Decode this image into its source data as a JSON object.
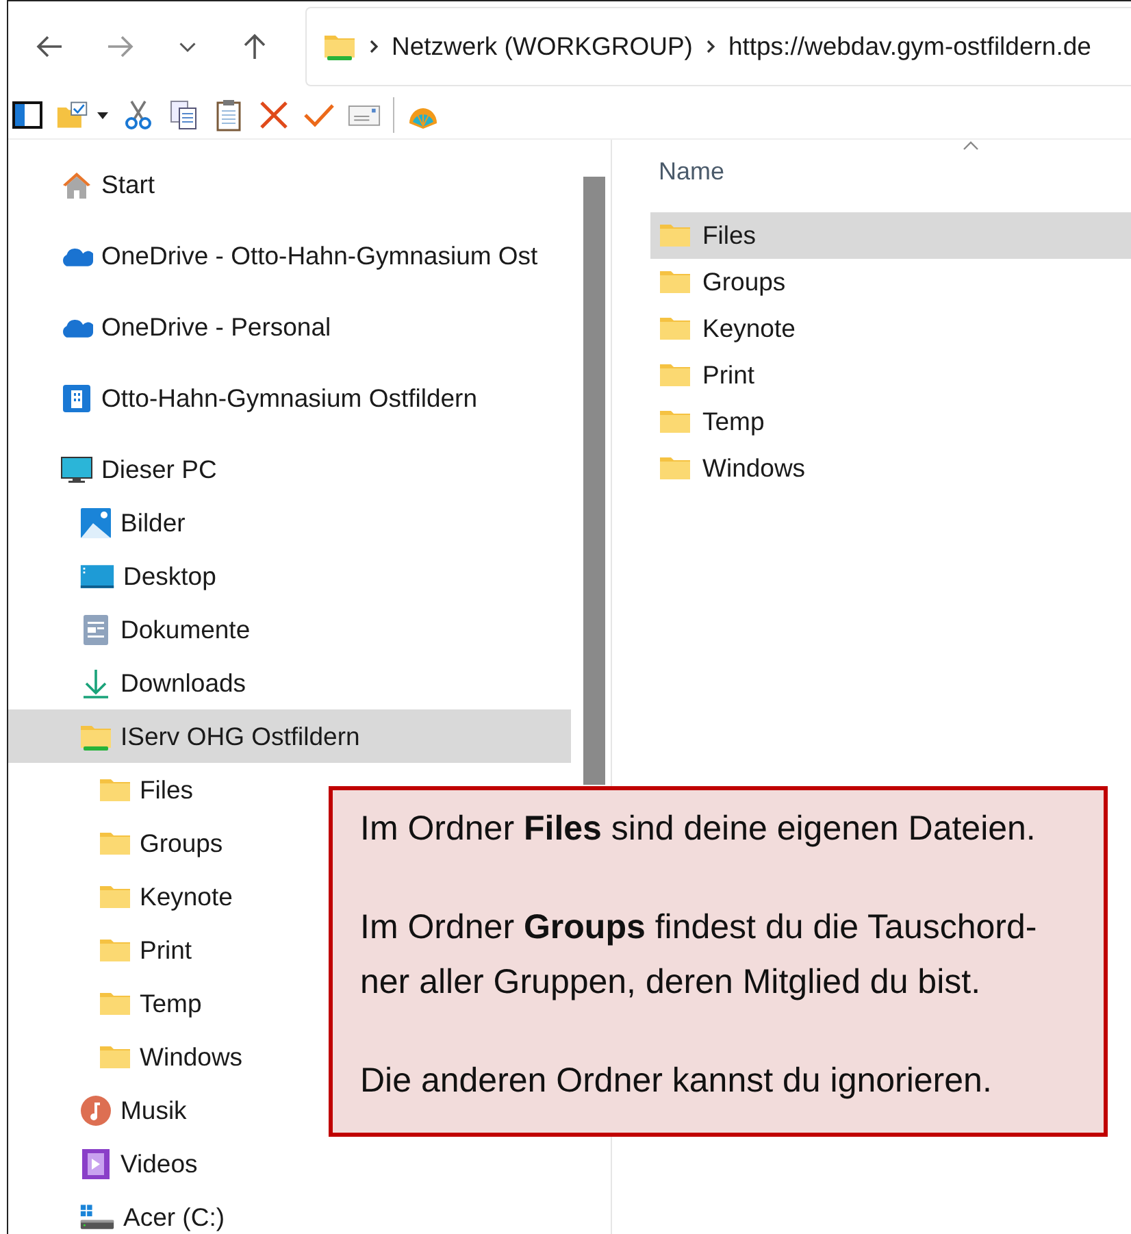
{
  "address_bar": {
    "crumbs": [
      "Netzwerk (WORKGROUP)",
      "https://webdav.gym-ostfildern.de"
    ]
  },
  "sidebar": {
    "items": [
      {
        "label": "Start",
        "kind": "home",
        "selected": false
      },
      {
        "label": "OneDrive - Otto-Hahn-Gymnasium Ost",
        "kind": "cloud",
        "selected": false
      },
      {
        "label": "OneDrive - Personal",
        "kind": "cloud",
        "selected": false
      },
      {
        "label": "Otto-Hahn-Gymnasium Ostfildern",
        "kind": "building",
        "selected": false
      },
      {
        "label": "Dieser PC",
        "kind": "pc",
        "selected": false,
        "children": [
          {
            "label": "Bilder",
            "kind": "pictures",
            "selected": false
          },
          {
            "label": "Desktop",
            "kind": "desktop",
            "selected": false
          },
          {
            "label": "Dokumente",
            "kind": "documents",
            "selected": false
          },
          {
            "label": "Downloads",
            "kind": "downloads",
            "selected": false
          },
          {
            "label": "IServ OHG Ostfildern",
            "kind": "netfolder",
            "selected": true,
            "children": [
              {
                "label": "Files",
                "kind": "folder",
                "selected": false
              },
              {
                "label": "Groups",
                "kind": "folder",
                "selected": false
              },
              {
                "label": "Keynote",
                "kind": "folder",
                "selected": false
              },
              {
                "label": "Print",
                "kind": "folder",
                "selected": false
              },
              {
                "label": "Temp",
                "kind": "folder",
                "selected": false
              },
              {
                "label": "Windows",
                "kind": "folder",
                "selected": false
              }
            ]
          },
          {
            "label": "Musik",
            "kind": "music",
            "selected": false
          },
          {
            "label": "Videos",
            "kind": "videos",
            "selected": false
          },
          {
            "label": "Acer (C:)",
            "kind": "drive",
            "selected": false
          }
        ]
      }
    ]
  },
  "file_list": {
    "column": "Name",
    "rows": [
      {
        "name": "Files",
        "selected": true
      },
      {
        "name": "Groups",
        "selected": false
      },
      {
        "name": "Keynote",
        "selected": false
      },
      {
        "name": "Print",
        "selected": false
      },
      {
        "name": "Temp",
        "selected": false
      },
      {
        "name": "Windows",
        "selected": false
      }
    ]
  },
  "callout": {
    "paragraphs": [
      {
        "lines": [
          "Im Ordner **Files** sind deine eigenen Dateien."
        ]
      },
      {
        "lines": [
          "Im Ordner **Groups** findest du die Tauschord-",
          "ner aller Gruppen, deren Mitglied du bist."
        ]
      },
      {
        "lines": [
          "Die anderen Ordner kannst du ignorieren."
        ]
      }
    ]
  }
}
